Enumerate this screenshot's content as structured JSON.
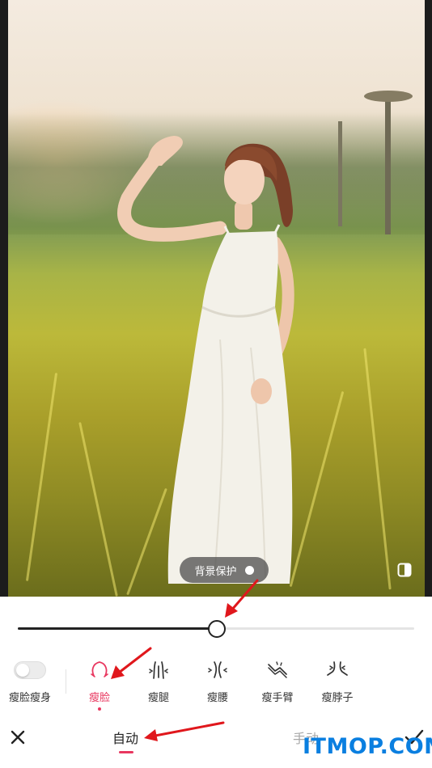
{
  "canvas": {
    "background_protect_label": "背景保护",
    "background_protect_enabled": false
  },
  "slider": {
    "value": 0.5
  },
  "controls": {
    "slim_face_body_label": "瘦脸瘦身",
    "slim_face_body_enabled": false
  },
  "tools": [
    {
      "label": "瘦脸",
      "icon": "face-outline-icon",
      "active": true
    },
    {
      "label": "瘦腿",
      "icon": "legs-icon",
      "active": false
    },
    {
      "label": "瘦腰",
      "icon": "waist-icon",
      "active": false
    },
    {
      "label": "瘦手臂",
      "icon": "arm-icon",
      "active": false
    },
    {
      "label": "瘦脖子",
      "icon": "neck-icon",
      "active": false
    }
  ],
  "bottom_bar": {
    "tab_auto": "自动",
    "tab_manual": "手动",
    "active_tab": "自动"
  },
  "watermark": "ITMOP.COM",
  "colors": {
    "accent": "#e8375f",
    "annotation_arrow": "#e0171c",
    "watermark": "#0a7fe0"
  }
}
